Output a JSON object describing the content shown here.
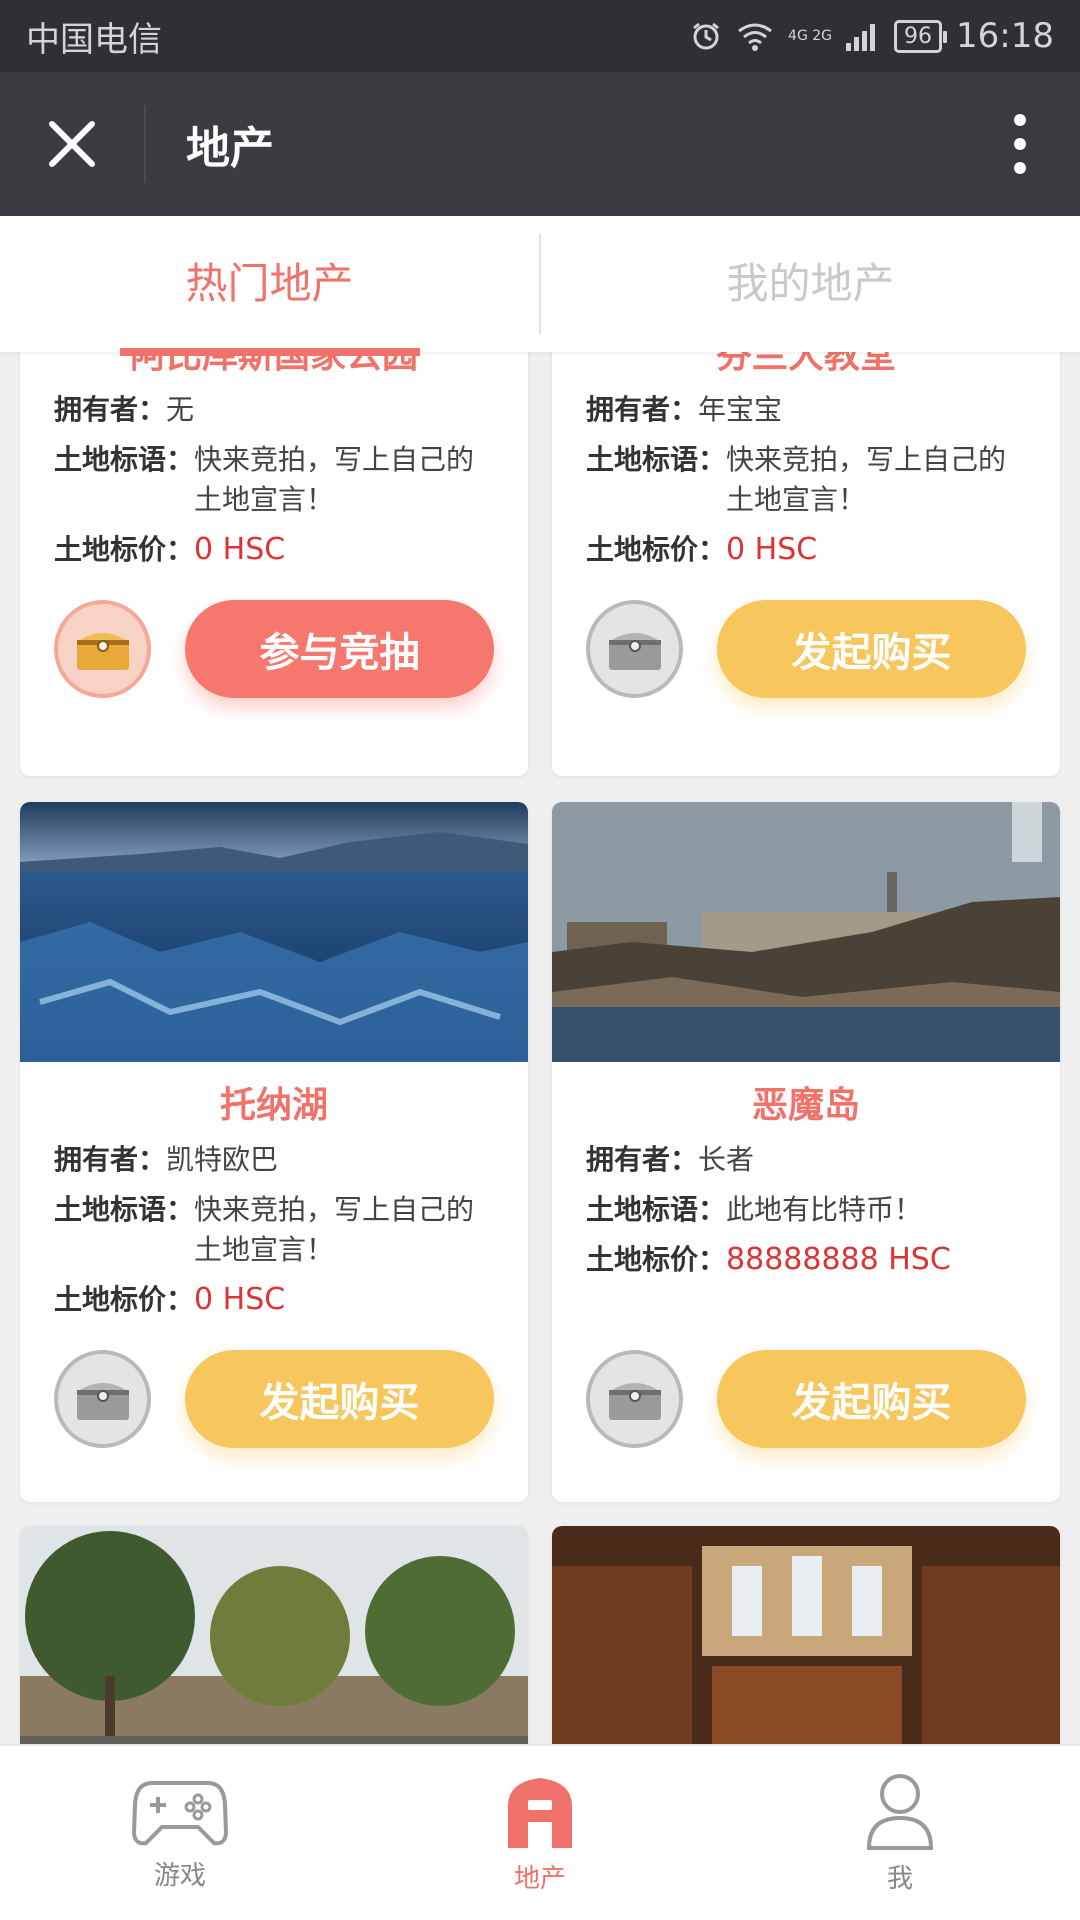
{
  "status_bar": {
    "carrier": "中国电信",
    "network": "4G 2G",
    "battery": "96",
    "time": "16:18"
  },
  "nav": {
    "title": "地产"
  },
  "tabs": [
    {
      "label": "热门地产",
      "active": true
    },
    {
      "label": "我的地产",
      "active": false
    }
  ],
  "labels": {
    "owner": "拥有者：",
    "slogan": "土地标语：",
    "price": "土地标价："
  },
  "cards": [
    {
      "title": "阿比库斯国家公园",
      "owner": "无",
      "slogan": "快来竞拍，写上自己的土地宣言！",
      "price": "0 HSC",
      "button": "参与竞抽",
      "button_style": "red",
      "chest": "gold"
    },
    {
      "title": "芬兰大教堂",
      "owner": "年宝宝",
      "slogan": "快来竞拍，写上自己的土地宣言！",
      "price": "0 HSC",
      "button": "发起购买",
      "button_style": "yellow",
      "chest": "grey"
    },
    {
      "title": "托纳湖",
      "owner": "凯特欧巴",
      "slogan": "快来竞拍，写上自己的土地宣言！",
      "price": "0 HSC",
      "button": "发起购买",
      "button_style": "yellow",
      "chest": "grey"
    },
    {
      "title": "恶魔岛",
      "owner": "长者",
      "slogan": "此地有比特币！",
      "price": "88888888 HSC",
      "button": "发起购买",
      "button_style": "yellow",
      "chest": "grey"
    }
  ],
  "bottom_tabs": [
    {
      "label": "游戏",
      "icon": "gamepad-icon",
      "active": false
    },
    {
      "label": "地产",
      "icon": "house-icon",
      "active": true
    },
    {
      "label": "我",
      "icon": "person-icon",
      "active": false
    }
  ],
  "colors": {
    "accent": "#f0726a",
    "yellow": "#f7c65c",
    "price": "#d33333",
    "nav_bg": "#3b3c41"
  }
}
